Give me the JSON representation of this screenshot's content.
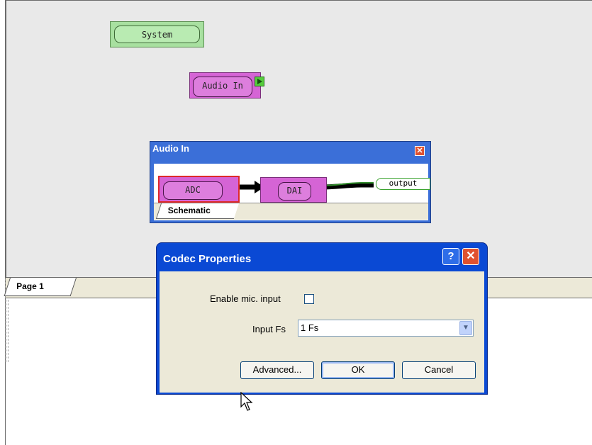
{
  "canvas": {
    "blocks": {
      "system": "System",
      "audio_in": "Audio In"
    },
    "page_tab": "Page 1"
  },
  "subwindow": {
    "title": "Audio In",
    "close_glyph": "✕",
    "adc": "ADC",
    "dai": "DAI",
    "output": "output",
    "tab": "Schematic"
  },
  "dialog": {
    "title": "Codec Properties",
    "help_glyph": "?",
    "close_glyph": "✕",
    "mic_label": "Enable mic. input",
    "mic_checked": false,
    "fs_label": "Input Fs",
    "fs_value": "1 Fs",
    "buttons": {
      "advanced": "Advanced...",
      "ok": "OK",
      "cancel": "Cancel"
    }
  },
  "colors": {
    "title_bar": "#0a49d4",
    "dialog_body": "#ece9d8",
    "block_purple": "#d564d5",
    "block_green": "#a8e0a0"
  }
}
